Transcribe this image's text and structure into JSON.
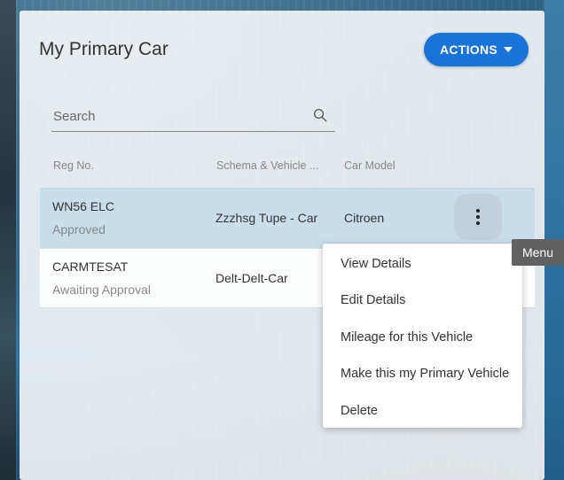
{
  "card": {
    "title": "My Primary Car",
    "actions_label": "ACTIONS"
  },
  "search": {
    "placeholder": "Search",
    "value": ""
  },
  "table": {
    "headers": [
      "Reg No.",
      "Schema & Vehicle ...",
      "Car Model"
    ],
    "rows": [
      {
        "reg": "WN56 ELC",
        "status": "Approved",
        "schema": "Zzzhsg Tupe - Car",
        "model": "Citroen"
      },
      {
        "reg": "CARMTESAT",
        "status": "Awaiting Approval",
        "schema": "Delt-Delt-Car",
        "model": ""
      }
    ]
  },
  "tooltip": {
    "text": "Menu"
  },
  "context_menu": {
    "items": [
      "View Details",
      "Edit Details",
      "Mileage for this Vehicle",
      "Make this my Primary Vehicle",
      "Delete"
    ]
  },
  "colors": {
    "accent": "#1a73d9",
    "selected_row": "#c6dce8",
    "tooltip_bg": "#616161"
  }
}
